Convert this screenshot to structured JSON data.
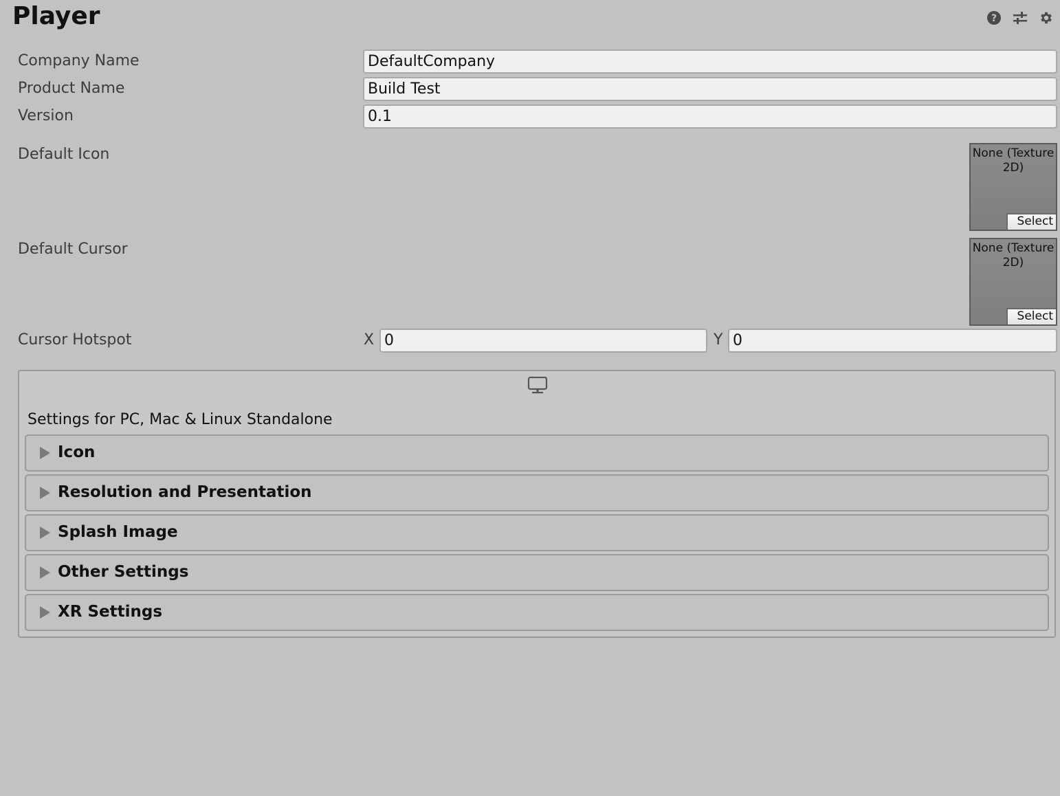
{
  "header": {
    "title": "Player",
    "icons": [
      "help-icon",
      "preset-sliders-icon",
      "gear-icon"
    ]
  },
  "fields": {
    "company_name": {
      "label": "Company Name",
      "value": "DefaultCompany"
    },
    "product_name": {
      "label": "Product Name",
      "value": "Build Test"
    },
    "version": {
      "label": "Version",
      "value": "0.1"
    }
  },
  "default_icon": {
    "label": "Default Icon",
    "value": "None (Texture 2D)",
    "select_label": "Select"
  },
  "default_cursor": {
    "label": "Default Cursor",
    "value": "None (Texture 2D)",
    "select_label": "Select"
  },
  "cursor_hotspot": {
    "label": "Cursor Hotspot",
    "x_label": "X",
    "x_value": "0",
    "y_label": "Y",
    "y_value": "0"
  },
  "platform": {
    "icon": "monitor-icon",
    "title": "Settings for PC, Mac & Linux Standalone",
    "sections": [
      {
        "label": "Icon",
        "expanded": false
      },
      {
        "label": "Resolution and Presentation",
        "expanded": false
      },
      {
        "label": "Splash Image",
        "expanded": false
      },
      {
        "label": "Other Settings",
        "expanded": false
      },
      {
        "label": "XR Settings",
        "expanded": false
      }
    ]
  }
}
